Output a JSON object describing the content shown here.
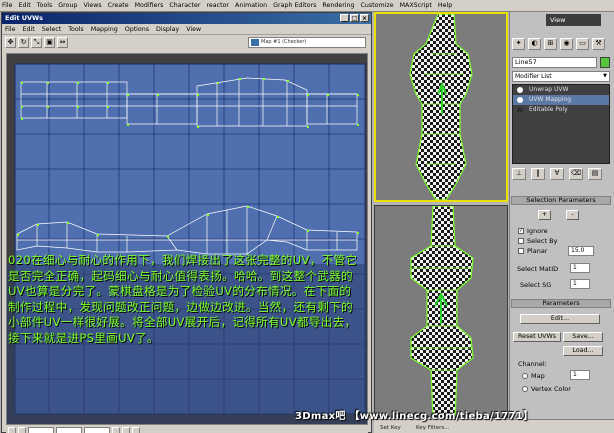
{
  "main_menu": [
    "File",
    "Edit",
    "Tools",
    "Group",
    "Views",
    "Create",
    "Modifiers",
    "Character",
    "reactor",
    "Animation",
    "Graph Editors",
    "Rendering",
    "Customize",
    "MAXScript",
    "Help"
  ],
  "uv_window": {
    "title": "Edit UVWs",
    "menu": [
      "File",
      "Edit",
      "Select",
      "Tools",
      "Mapping",
      "Options",
      "Display",
      "View"
    ],
    "map_dropdown": "Map #1 (Checker)"
  },
  "caption": "020在细心与耐心的作用下，我们焊接出了这张完整的UV，不管它是否完全正确，起码细心与耐心值得表扬。哈哈。到这整个武器的UV也算是分完了。蒙棋盘格是为了检验UV的分布情况。在下面的制作过程中，发现问题改正问题，边做边改进。当然，还有剩下的小部件UV一样很好展。将全部UV展开后，记得所有UV都导出去，接下来就是进PS里画UV了。",
  "viewport": {
    "view_label": "View"
  },
  "command_panel": {
    "object_name": "Line57",
    "object_color": "#58c63a",
    "modifier_list_label": "Modifier List",
    "stack": [
      {
        "label": "Unwrap UVW",
        "selected": false
      },
      {
        "label": "UVW Mapping",
        "selected": true
      },
      {
        "label": "Editable Poly",
        "selected": false
      }
    ],
    "selection_params": {
      "title": "Selection Parameters",
      "plus": "+",
      "minus": "-",
      "ignore_label": "Ignore",
      "select_by_label": "Select By",
      "planar_label": "Planar",
      "planar_value": "15.0",
      "select_matid_label": "Select MatID",
      "select_sg_label": "Select SG",
      "matid_value": "1",
      "sg_value": "1"
    },
    "parameters": {
      "title": "Parameters",
      "edit_button": "Edit...",
      "reset_uvws_button": "Reset UVWs",
      "save_button": "Save...",
      "load_button": "Load...",
      "channel_label": "Channel:",
      "map_label": "Map",
      "map_value": "1",
      "vertex_color_label": "Vertex Color"
    }
  },
  "status_bar": {
    "set_key": "Set Key",
    "key_filters": "Key Filters..."
  },
  "watermark": "3Dmax吧 【www.linecg.com/tieba/1771】"
}
